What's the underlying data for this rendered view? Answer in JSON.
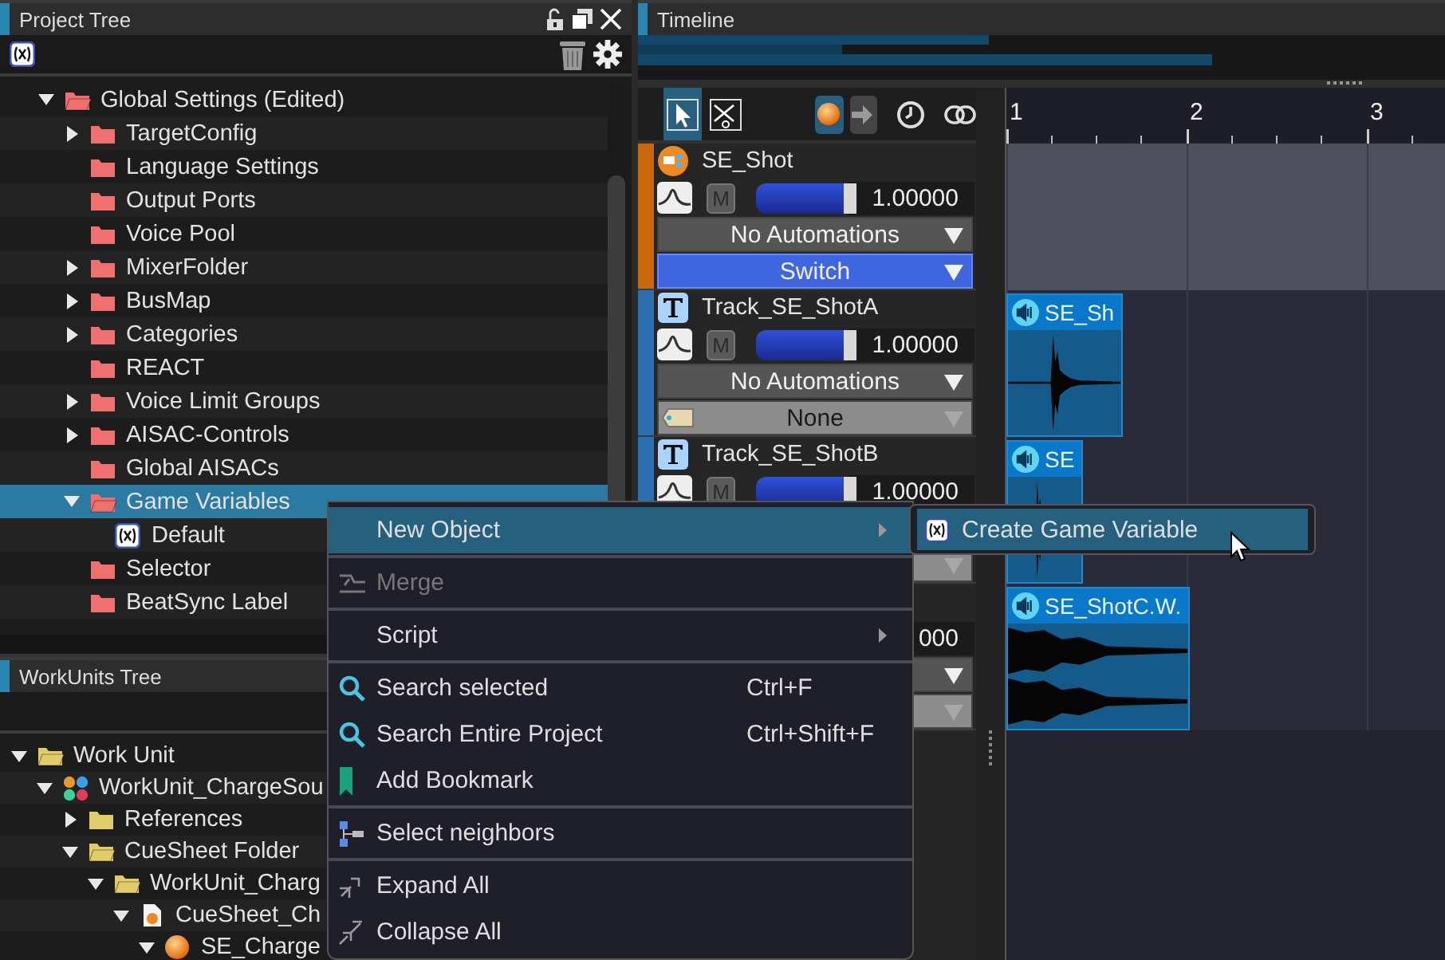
{
  "project_tree": {
    "title": "Project Tree",
    "items": [
      {
        "label": "Global Settings (Edited)",
        "kind": "folder",
        "expanded": true,
        "selected": false,
        "children": [
          {
            "label": "TargetConfig",
            "kind": "folder",
            "expanded": false,
            "selected": false
          },
          {
            "label": "Language Settings",
            "kind": "folder",
            "selected": false
          },
          {
            "label": "Output Ports",
            "kind": "folder",
            "selected": false
          },
          {
            "label": "Voice Pool",
            "kind": "folder",
            "selected": false
          },
          {
            "label": "MixerFolder",
            "kind": "folder",
            "expanded": false,
            "selected": false
          },
          {
            "label": "BusMap",
            "kind": "folder",
            "expanded": false,
            "selected": false
          },
          {
            "label": "Categories",
            "kind": "folder",
            "expanded": false,
            "selected": false
          },
          {
            "label": "REACT",
            "kind": "folder",
            "selected": false
          },
          {
            "label": "Voice Limit Groups",
            "kind": "folder",
            "expanded": false,
            "selected": false
          },
          {
            "label": "AISAC-Controls",
            "kind": "folder",
            "expanded": false,
            "selected": false
          },
          {
            "label": "Global AISACs",
            "kind": "folder",
            "selected": false
          },
          {
            "label": "Game Variables",
            "kind": "folder",
            "expanded": true,
            "selected": true,
            "children": [
              {
                "label": "Default",
                "kind": "variable",
                "selected": false
              }
            ]
          },
          {
            "label": "Selector",
            "kind": "folder",
            "selected": false
          },
          {
            "label": "BeatSync Label",
            "kind": "folder",
            "selected": false
          }
        ]
      }
    ]
  },
  "work_units_tree": {
    "title": "WorkUnits Tree",
    "items": [
      {
        "label": "Work Unit",
        "kind": "folder",
        "expanded": true,
        "selected": false,
        "children": [
          {
            "label": "WorkUnit_ChargeSou",
            "kind": "workunit",
            "expanded": true,
            "selected": false,
            "children": [
              {
                "label": "References",
                "kind": "folder",
                "expanded": false,
                "selected": false
              },
              {
                "label": "CueSheet Folder",
                "kind": "folder",
                "expanded": true,
                "selected": false,
                "children": [
                  {
                    "label": "WorkUnit_Charg",
                    "kind": "folder",
                    "expanded": true,
                    "selected": false,
                    "children": [
                      {
                        "label": "CueSheet_Ch",
                        "kind": "cuesheet",
                        "expanded": true,
                        "selected": false,
                        "children": [
                          {
                            "label": "SE_Charge",
                            "kind": "cue",
                            "expanded": true,
                            "selected": false
                          }
                        ]
                      }
                    ]
                  }
                ]
              }
            ]
          }
        ]
      }
    ]
  },
  "timeline": {
    "title": "Timeline",
    "tools": [
      {
        "kind": "pointer",
        "selected": true
      },
      {
        "kind": "scissors",
        "selected": false
      }
    ],
    "toggles": [
      {
        "kind": "ball",
        "selected": true
      },
      {
        "kind": "arrow",
        "selected": false
      }
    ],
    "ruler": [
      "1",
      "2",
      "3"
    ],
    "tracks": [
      {
        "name": "SE_Shot",
        "kind": "cue",
        "color": "#c8680a",
        "mute_label": "M",
        "muted": false,
        "level": 0.83,
        "value": "1.00000",
        "automation": "No Automations",
        "selector": {
          "label": "Switch",
          "active": true
        }
      },
      {
        "name": "Track_SE_ShotA",
        "kind": "track",
        "color": "#2a6fb0",
        "mute_label": "M",
        "muted": false,
        "level": 0.83,
        "value": "1.00000",
        "automation": "No Automations",
        "selector": {
          "label": "None",
          "active": false
        },
        "clip": {
          "label": "SE_Sh",
          "kind": "mono"
        }
      },
      {
        "name": "Track_SE_ShotB",
        "kind": "track",
        "color": "#2a6fb0",
        "mute_label": "M",
        "muted": false,
        "level": 0.83,
        "value": "1.00000",
        "selector": {
          "active": false
        },
        "clip": {
          "label": "SE",
          "kind": "mono"
        }
      },
      {
        "kind": "track",
        "value": "000",
        "selector": {
          "active": false
        },
        "clip": {
          "label": "SE_ShotC.W.",
          "kind": "stereo"
        }
      }
    ]
  },
  "context_menu": {
    "items": [
      {
        "label": "New Object",
        "kind": "plain",
        "submenu": true,
        "selected": true,
        "disabled": false
      },
      {
        "kind": "separator"
      },
      {
        "label": "Merge",
        "kind": "merge",
        "submenu": false,
        "selected": false,
        "disabled": true
      },
      {
        "kind": "separator"
      },
      {
        "label": "Script",
        "kind": "plain",
        "submenu": true,
        "selected": false,
        "disabled": false
      },
      {
        "kind": "separator"
      },
      {
        "label": "Search selected",
        "kind": "search",
        "shortcut": "Ctrl+F",
        "submenu": false,
        "selected": false,
        "disabled": false
      },
      {
        "label": "Search Entire Project",
        "kind": "search",
        "shortcut": "Ctrl+Shift+F",
        "submenu": false,
        "selected": false,
        "disabled": false
      },
      {
        "label": "Add Bookmark",
        "kind": "bookmark",
        "submenu": false,
        "selected": false,
        "disabled": false
      },
      {
        "kind": "separator"
      },
      {
        "label": "Select neighbors",
        "kind": "neighbors",
        "submenu": false,
        "selected": false,
        "disabled": false
      },
      {
        "kind": "separator"
      },
      {
        "label": "Expand All",
        "kind": "expand",
        "submenu": false,
        "selected": false,
        "disabled": false
      },
      {
        "label": "Collapse All",
        "kind": "collapse",
        "submenu": false,
        "selected": false,
        "disabled": false
      }
    ]
  },
  "submenu": {
    "items": [
      {
        "label": "Create Game Variable",
        "kind": "variable",
        "selected": true
      }
    ]
  }
}
